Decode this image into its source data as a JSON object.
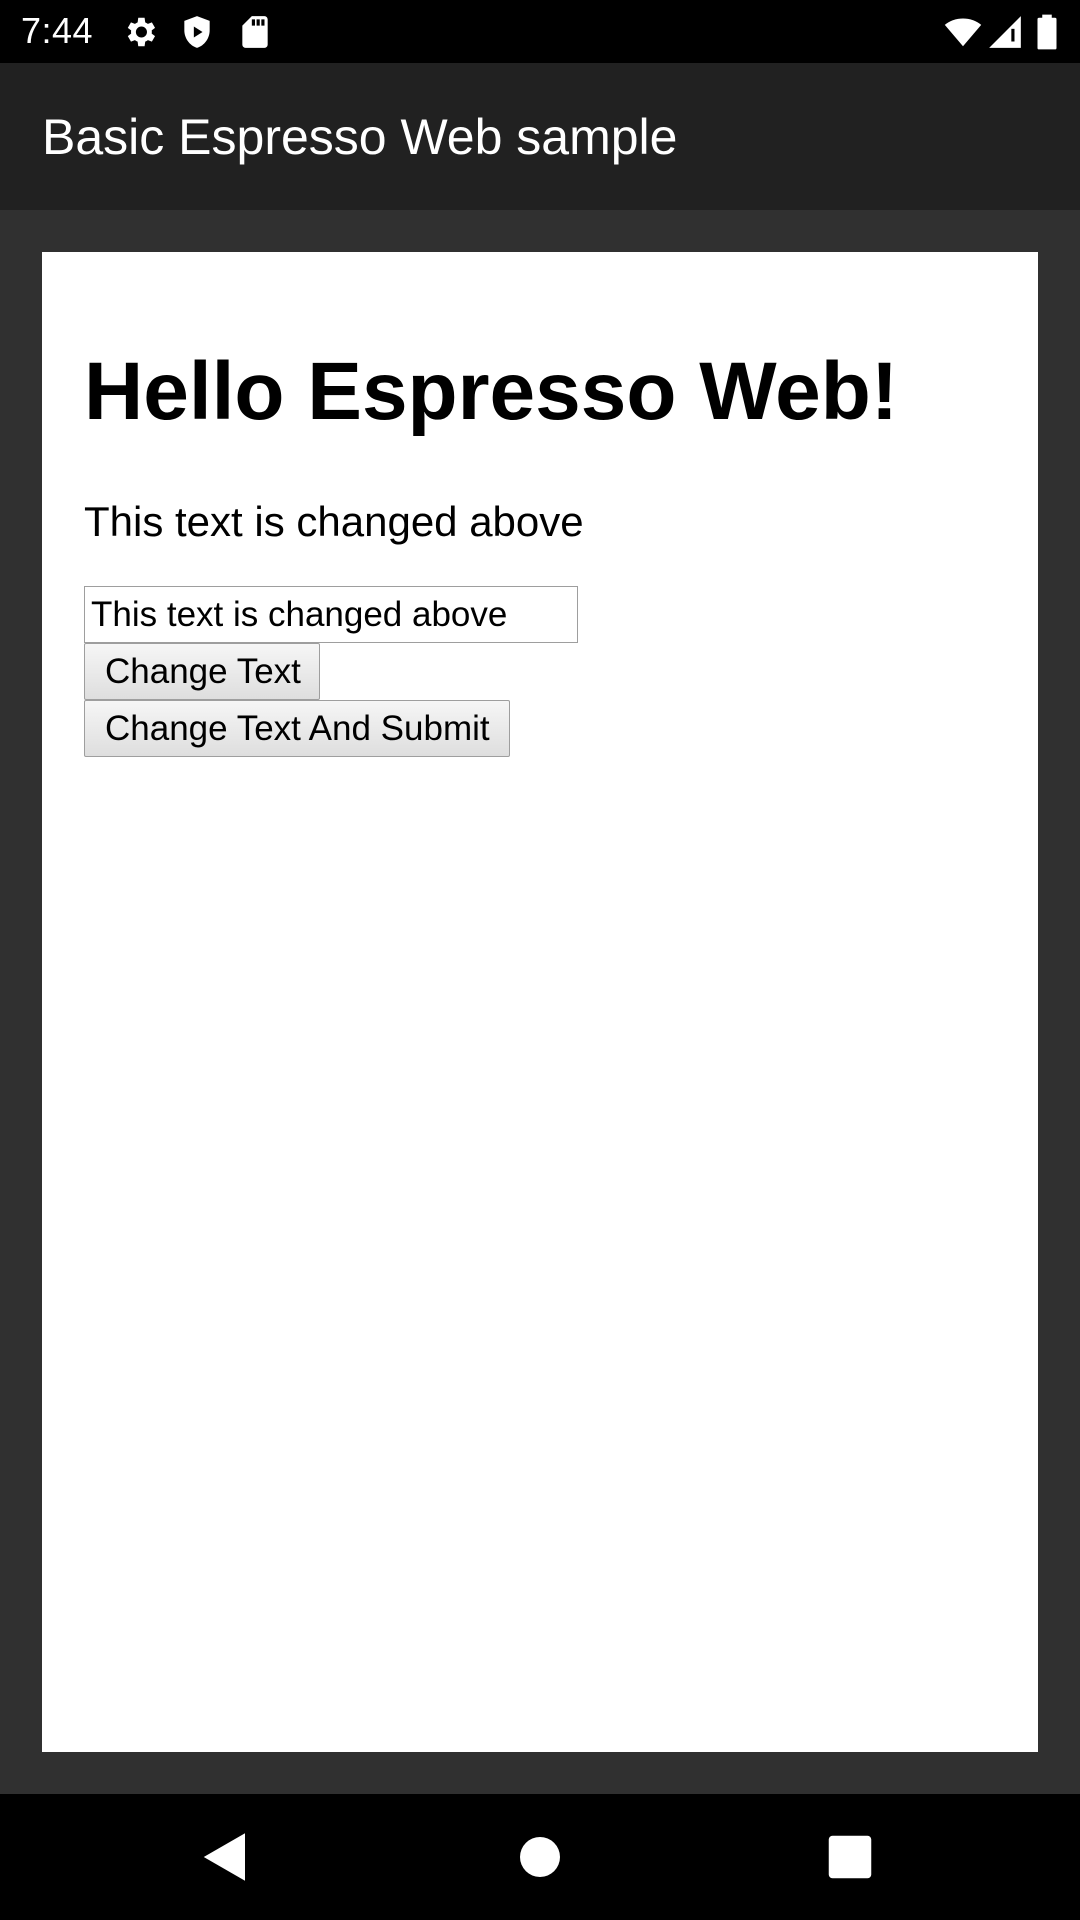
{
  "status_bar": {
    "time": "7:44",
    "icons_left": [
      "gear-icon",
      "shield-play-icon",
      "sd-card-icon"
    ],
    "icons_right": [
      "wifi-icon",
      "cell-signal-icon",
      "battery-icon"
    ]
  },
  "app_bar": {
    "title": "Basic Espresso Web sample",
    "background": "#212121"
  },
  "webview": {
    "heading": "Hello Espresso Web!",
    "message": "This text is changed above",
    "text_input_value": "This text is changed above",
    "change_text_button": "Change Text",
    "change_text_submit_button": "Change Text And Submit"
  },
  "nav_bar": {
    "buttons": [
      "back-icon",
      "home-icon",
      "recents-icon"
    ]
  },
  "colors": {
    "content_background": "#303030",
    "page_background": "#ffffff"
  }
}
